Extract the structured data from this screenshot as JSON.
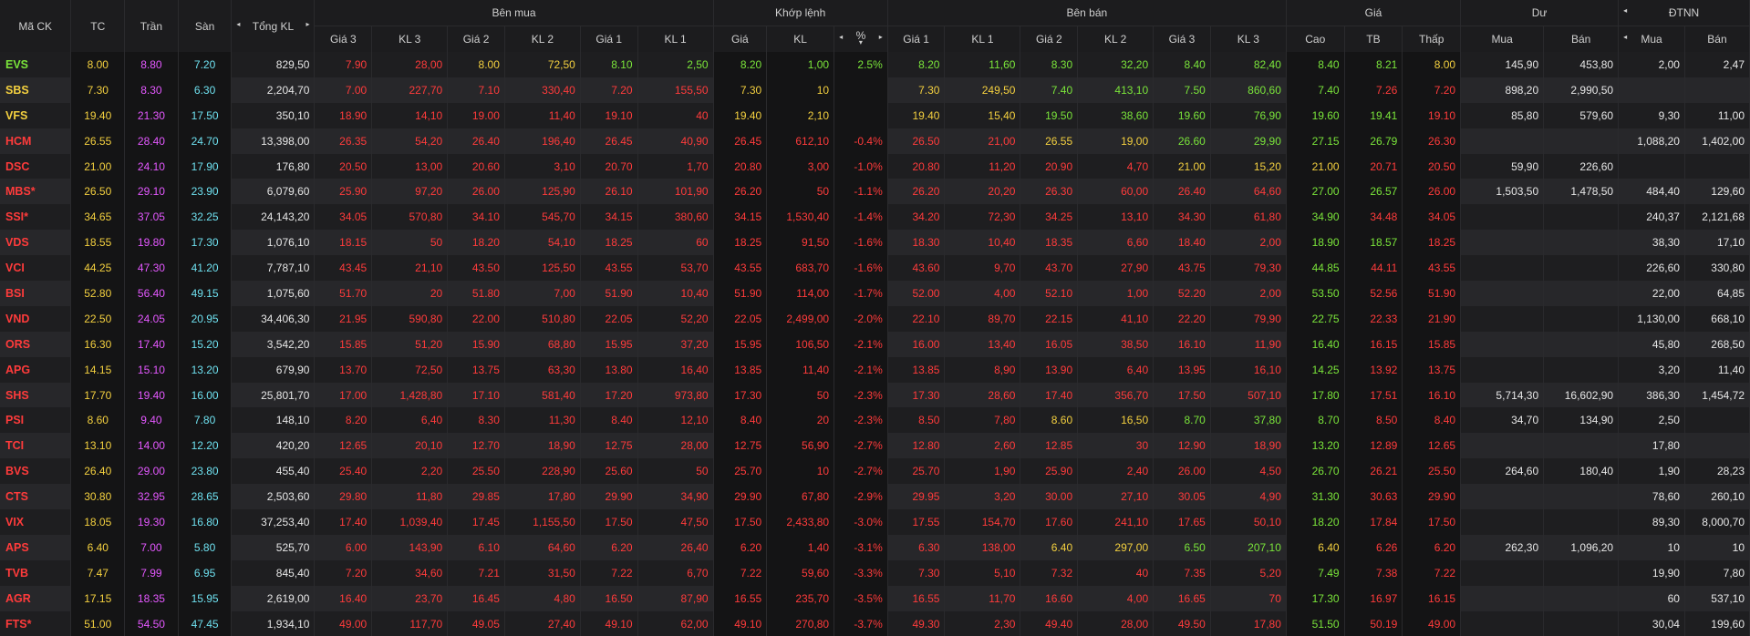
{
  "header": {
    "symbol": "Mã CK",
    "tc": "TC",
    "tran": "Trần",
    "san": "Sàn",
    "total_vol": "Tổng KL",
    "buy_group": "Bên mua",
    "match_group": "Khớp lệnh",
    "sell_group": "Bên bán",
    "price_group": "Giá",
    "residual_group": "Dư",
    "foreign_group": "ĐTNN",
    "gia3": "Giá 3",
    "kl3": "KL 3",
    "gia2": "Giá 2",
    "kl2": "KL 2",
    "gia1": "Giá 1",
    "kl1": "KL 1",
    "match_price": "Giá",
    "match_vol": "KL",
    "match_pct": "%",
    "high": "Cao",
    "avg": "TB",
    "low": "Thấp",
    "res_buy": "Mua",
    "res_sell": "Bán",
    "f_buy": "Mua",
    "f_sell": "Bán"
  },
  "icons": {
    "arrow_left": "◂",
    "arrow_right": "▸",
    "sort_down": "▾"
  },
  "colors": {
    "up": "#7ae43a",
    "down": "#ff3b3b",
    "reference": "#f4d03f",
    "ceiling": "#e458ff",
    "floor": "#6ee0ef"
  },
  "rows": [
    {
      "sym": "EVS",
      "st": "up",
      "tc": "8.00",
      "tr": "8.80",
      "sa": "7.20",
      "tot": "829,50",
      "b3p": "7.90",
      "b3pc": "dn",
      "b3v": "28,00",
      "b2p": "8.00",
      "b2pc": "ref",
      "b2v": "72,50",
      "b1p": "8.10",
      "b1pc": "up",
      "b1v": "2,50",
      "mp": "8.20",
      "mv": "1,00",
      "mpct": "2.5%",
      "mc": "up",
      "s1p": "8.20",
      "s1pc": "up",
      "s1v": "11,60",
      "s2p": "8.30",
      "s2pc": "up",
      "s2v": "32,20",
      "s3p": "8.40",
      "s3pc": "up",
      "s3v": "82,40",
      "hi": "8.40",
      "hic": "up",
      "av": "8.21",
      "avc": "up",
      "lo": "8.00",
      "loc": "ref",
      "rb": "145,90",
      "rs": "453,80",
      "fb": "2,00",
      "fs": "2,47"
    },
    {
      "sym": "SBS",
      "st": "ref",
      "tc": "7.30",
      "tr": "8.30",
      "sa": "6.30",
      "tot": "2,204,70",
      "b3p": "7.00",
      "b3pc": "dn",
      "b3v": "227,70",
      "b2p": "7.10",
      "b2pc": "dn",
      "b2v": "330,40",
      "b1p": "7.20",
      "b1pc": "dn",
      "b1v": "155,50",
      "mp": "7.30",
      "mv": "10",
      "mpct": "",
      "mc": "ref",
      "s1p": "7.30",
      "s1pc": "ref",
      "s1v": "249,50",
      "s2p": "7.40",
      "s2pc": "up",
      "s2v": "413,10",
      "s3p": "7.50",
      "s3pc": "up",
      "s3v": "860,60",
      "hi": "7.40",
      "hic": "up",
      "av": "7.26",
      "avc": "dn",
      "lo": "7.20",
      "loc": "dn",
      "rb": "898,20",
      "rs": "2,990,50",
      "fb": "",
      "fs": ""
    },
    {
      "sym": "VFS",
      "st": "ref",
      "tc": "19.40",
      "tr": "21.30",
      "sa": "17.50",
      "tot": "350,10",
      "b3p": "18.90",
      "b3pc": "dn",
      "b3v": "14,10",
      "b2p": "19.00",
      "b2pc": "dn",
      "b2v": "11,40",
      "b1p": "19.10",
      "b1pc": "dn",
      "b1v": "40",
      "mp": "19.40",
      "mv": "2,10",
      "mpct": "",
      "mc": "ref",
      "s1p": "19.40",
      "s1pc": "ref",
      "s1v": "15,40",
      "s2p": "19.50",
      "s2pc": "up",
      "s2v": "38,60",
      "s3p": "19.60",
      "s3pc": "up",
      "s3v": "76,90",
      "hi": "19.60",
      "hic": "up",
      "av": "19.41",
      "avc": "up",
      "lo": "19.10",
      "loc": "dn",
      "rb": "85,80",
      "rs": "579,60",
      "fb": "9,30",
      "fs": "11,00"
    },
    {
      "sym": "HCM",
      "st": "dn",
      "tc": "26.55",
      "tr": "28.40",
      "sa": "24.70",
      "tot": "13,398,00",
      "b3p": "26.35",
      "b3pc": "dn",
      "b3v": "54,20",
      "b2p": "26.40",
      "b2pc": "dn",
      "b2v": "196,40",
      "b1p": "26.45",
      "b1pc": "dn",
      "b1v": "40,90",
      "mp": "26.45",
      "mv": "612,10",
      "mpct": "-0.4%",
      "mc": "dn",
      "s1p": "26.50",
      "s1pc": "dn",
      "s1v": "21,00",
      "s2p": "26.55",
      "s2pc": "ref",
      "s2v": "19,00",
      "s3p": "26.60",
      "s3pc": "up",
      "s3v": "29,90",
      "hi": "27.15",
      "hic": "up",
      "av": "26.79",
      "avc": "up",
      "lo": "26.30",
      "loc": "dn",
      "rb": "",
      "rs": "",
      "fb": "1,088,20",
      "fs": "1,402,00"
    },
    {
      "sym": "DSC",
      "st": "dn",
      "tc": "21.00",
      "tr": "24.10",
      "sa": "17.90",
      "tot": "176,80",
      "b3p": "20.50",
      "b3pc": "dn",
      "b3v": "13,00",
      "b2p": "20.60",
      "b2pc": "dn",
      "b2v": "3,10",
      "b1p": "20.70",
      "b1pc": "dn",
      "b1v": "1,70",
      "mp": "20.80",
      "mv": "3,00",
      "mpct": "-1.0%",
      "mc": "dn",
      "s1p": "20.80",
      "s1pc": "dn",
      "s1v": "11,20",
      "s2p": "20.90",
      "s2pc": "dn",
      "s2v": "4,70",
      "s3p": "21.00",
      "s3pc": "ref",
      "s3v": "15,20",
      "hi": "21.00",
      "hic": "ref",
      "av": "20.71",
      "avc": "dn",
      "lo": "20.50",
      "loc": "dn",
      "rb": "59,90",
      "rs": "226,60",
      "fb": "",
      "fs": ""
    },
    {
      "sym": "MBS*",
      "st": "dn",
      "tc": "26.50",
      "tr": "29.10",
      "sa": "23.90",
      "tot": "6,079,60",
      "b3p": "25.90",
      "b3pc": "dn",
      "b3v": "97,20",
      "b2p": "26.00",
      "b2pc": "dn",
      "b2v": "125,90",
      "b1p": "26.10",
      "b1pc": "dn",
      "b1v": "101,90",
      "mp": "26.20",
      "mv": "50",
      "mpct": "-1.1%",
      "mc": "dn",
      "s1p": "26.20",
      "s1pc": "dn",
      "s1v": "20,20",
      "s2p": "26.30",
      "s2pc": "dn",
      "s2v": "60,00",
      "s3p": "26.40",
      "s3pc": "dn",
      "s3v": "64,60",
      "hi": "27.00",
      "hic": "up",
      "av": "26.57",
      "avc": "up",
      "lo": "26.00",
      "loc": "dn",
      "rb": "1,503,50",
      "rs": "1,478,50",
      "fb": "484,40",
      "fs": "129,60"
    },
    {
      "sym": "SSI*",
      "st": "dn",
      "tc": "34.65",
      "tr": "37.05",
      "sa": "32.25",
      "tot": "24,143,20",
      "b3p": "34.05",
      "b3pc": "dn",
      "b3v": "570,80",
      "b2p": "34.10",
      "b2pc": "dn",
      "b2v": "545,70",
      "b1p": "34.15",
      "b1pc": "dn",
      "b1v": "380,60",
      "mp": "34.15",
      "mv": "1,530,40",
      "mpct": "-1.4%",
      "mc": "dn",
      "s1p": "34.20",
      "s1pc": "dn",
      "s1v": "72,30",
      "s2p": "34.25",
      "s2pc": "dn",
      "s2v": "13,10",
      "s3p": "34.30",
      "s3pc": "dn",
      "s3v": "61,80",
      "hi": "34.90",
      "hic": "up",
      "av": "34.48",
      "avc": "dn",
      "lo": "34.05",
      "loc": "dn",
      "rb": "",
      "rs": "",
      "fb": "240,37",
      "fs": "2,121,68"
    },
    {
      "sym": "VDS",
      "st": "dn",
      "tc": "18.55",
      "tr": "19.80",
      "sa": "17.30",
      "tot": "1,076,10",
      "b3p": "18.15",
      "b3pc": "dn",
      "b3v": "50",
      "b2p": "18.20",
      "b2pc": "dn",
      "b2v": "54,10",
      "b1p": "18.25",
      "b1pc": "dn",
      "b1v": "60",
      "mp": "18.25",
      "mv": "91,50",
      "mpct": "-1.6%",
      "mc": "dn",
      "s1p": "18.30",
      "s1pc": "dn",
      "s1v": "10,40",
      "s2p": "18.35",
      "s2pc": "dn",
      "s2v": "6,60",
      "s3p": "18.40",
      "s3pc": "dn",
      "s3v": "2,00",
      "hi": "18.90",
      "hic": "up",
      "av": "18.57",
      "avc": "up",
      "lo": "18.25",
      "loc": "dn",
      "rb": "",
      "rs": "",
      "fb": "38,30",
      "fs": "17,10"
    },
    {
      "sym": "VCI",
      "st": "dn",
      "tc": "44.25",
      "tr": "47.30",
      "sa": "41.20",
      "tot": "7,787,10",
      "b3p": "43.45",
      "b3pc": "dn",
      "b3v": "21,10",
      "b2p": "43.50",
      "b2pc": "dn",
      "b2v": "125,50",
      "b1p": "43.55",
      "b1pc": "dn",
      "b1v": "53,70",
      "mp": "43.55",
      "mv": "683,70",
      "mpct": "-1.6%",
      "mc": "dn",
      "s1p": "43.60",
      "s1pc": "dn",
      "s1v": "9,70",
      "s2p": "43.70",
      "s2pc": "dn",
      "s2v": "27,90",
      "s3p": "43.75",
      "s3pc": "dn",
      "s3v": "79,30",
      "hi": "44.85",
      "hic": "up",
      "av": "44.11",
      "avc": "dn",
      "lo": "43.55",
      "loc": "dn",
      "rb": "",
      "rs": "",
      "fb": "226,60",
      "fs": "330,80"
    },
    {
      "sym": "BSI",
      "st": "dn",
      "tc": "52.80",
      "tr": "56.40",
      "sa": "49.15",
      "tot": "1,075,60",
      "b3p": "51.70",
      "b3pc": "dn",
      "b3v": "20",
      "b2p": "51.80",
      "b2pc": "dn",
      "b2v": "7,00",
      "b1p": "51.90",
      "b1pc": "dn",
      "b1v": "10,40",
      "mp": "51.90",
      "mv": "114,00",
      "mpct": "-1.7%",
      "mc": "dn",
      "s1p": "52.00",
      "s1pc": "dn",
      "s1v": "4,00",
      "s2p": "52.10",
      "s2pc": "dn",
      "s2v": "1,00",
      "s3p": "52.20",
      "s3pc": "dn",
      "s3v": "2,00",
      "hi": "53.50",
      "hic": "up",
      "av": "52.56",
      "avc": "dn",
      "lo": "51.90",
      "loc": "dn",
      "rb": "",
      "rs": "",
      "fb": "22,00",
      "fs": "64,85"
    },
    {
      "sym": "VND",
      "st": "dn",
      "tc": "22.50",
      "tr": "24.05",
      "sa": "20.95",
      "tot": "34,406,30",
      "b3p": "21.95",
      "b3pc": "dn",
      "b3v": "590,80",
      "b2p": "22.00",
      "b2pc": "dn",
      "b2v": "510,80",
      "b1p": "22.05",
      "b1pc": "dn",
      "b1v": "52,20",
      "mp": "22.05",
      "mv": "2,499,00",
      "mpct": "-2.0%",
      "mc": "dn",
      "s1p": "22.10",
      "s1pc": "dn",
      "s1v": "89,70",
      "s2p": "22.15",
      "s2pc": "dn",
      "s2v": "41,10",
      "s3p": "22.20",
      "s3pc": "dn",
      "s3v": "79,90",
      "hi": "22.75",
      "hic": "up",
      "av": "22.33",
      "avc": "dn",
      "lo": "21.90",
      "loc": "dn",
      "rb": "",
      "rs": "",
      "fb": "1,130,00",
      "fs": "668,10"
    },
    {
      "sym": "ORS",
      "st": "dn",
      "tc": "16.30",
      "tr": "17.40",
      "sa": "15.20",
      "tot": "3,542,20",
      "b3p": "15.85",
      "b3pc": "dn",
      "b3v": "51,20",
      "b2p": "15.90",
      "b2pc": "dn",
      "b2v": "68,80",
      "b1p": "15.95",
      "b1pc": "dn",
      "b1v": "37,20",
      "mp": "15.95",
      "mv": "106,50",
      "mpct": "-2.1%",
      "mc": "dn",
      "s1p": "16.00",
      "s1pc": "dn",
      "s1v": "13,40",
      "s2p": "16.05",
      "s2pc": "dn",
      "s2v": "38,50",
      "s3p": "16.10",
      "s3pc": "dn",
      "s3v": "11,90",
      "hi": "16.40",
      "hic": "up",
      "av": "16.15",
      "avc": "dn",
      "lo": "15.85",
      "loc": "dn",
      "rb": "",
      "rs": "",
      "fb": "45,80",
      "fs": "268,50"
    },
    {
      "sym": "APG",
      "st": "dn",
      "tc": "14.15",
      "tr": "15.10",
      "sa": "13.20",
      "tot": "679,90",
      "b3p": "13.70",
      "b3pc": "dn",
      "b3v": "72,50",
      "b2p": "13.75",
      "b2pc": "dn",
      "b2v": "63,30",
      "b1p": "13.80",
      "b1pc": "dn",
      "b1v": "16,40",
      "mp": "13.85",
      "mv": "11,40",
      "mpct": "-2.1%",
      "mc": "dn",
      "s1p": "13.85",
      "s1pc": "dn",
      "s1v": "8,90",
      "s2p": "13.90",
      "s2pc": "dn",
      "s2v": "6,40",
      "s3p": "13.95",
      "s3pc": "dn",
      "s3v": "16,10",
      "hi": "14.25",
      "hic": "up",
      "av": "13.92",
      "avc": "dn",
      "lo": "13.75",
      "loc": "dn",
      "rb": "",
      "rs": "",
      "fb": "3,20",
      "fs": "11,40"
    },
    {
      "sym": "SHS",
      "st": "dn",
      "tc": "17.70",
      "tr": "19.40",
      "sa": "16.00",
      "tot": "25,801,70",
      "b3p": "17.00",
      "b3pc": "dn",
      "b3v": "1,428,80",
      "b2p": "17.10",
      "b2pc": "dn",
      "b2v": "581,40",
      "b1p": "17.20",
      "b1pc": "dn",
      "b1v": "973,80",
      "mp": "17.30",
      "mv": "50",
      "mpct": "-2.3%",
      "mc": "dn",
      "s1p": "17.30",
      "s1pc": "dn",
      "s1v": "28,60",
      "s2p": "17.40",
      "s2pc": "dn",
      "s2v": "356,70",
      "s3p": "17.50",
      "s3pc": "dn",
      "s3v": "507,10",
      "hi": "17.80",
      "hic": "up",
      "av": "17.51",
      "avc": "dn",
      "lo": "16.10",
      "loc": "dn",
      "rb": "5,714,30",
      "rs": "16,602,90",
      "fb": "386,30",
      "fs": "1,454,72"
    },
    {
      "sym": "PSI",
      "st": "dn",
      "tc": "8.60",
      "tr": "9.40",
      "sa": "7.80",
      "tot": "148,10",
      "b3p": "8.20",
      "b3pc": "dn",
      "b3v": "6,40",
      "b2p": "8.30",
      "b2pc": "dn",
      "b2v": "11,30",
      "b1p": "8.40",
      "b1pc": "dn",
      "b1v": "12,10",
      "mp": "8.40",
      "mv": "20",
      "mpct": "-2.3%",
      "mc": "dn",
      "s1p": "8.50",
      "s1pc": "dn",
      "s1v": "7,80",
      "s2p": "8.60",
      "s2pc": "ref",
      "s2v": "16,50",
      "s3p": "8.70",
      "s3pc": "up",
      "s3v": "37,80",
      "hi": "8.70",
      "hic": "up",
      "av": "8.50",
      "avc": "dn",
      "lo": "8.40",
      "loc": "dn",
      "rb": "34,70",
      "rs": "134,90",
      "fb": "2,50",
      "fs": ""
    },
    {
      "sym": "TCI",
      "st": "dn",
      "tc": "13.10",
      "tr": "14.00",
      "sa": "12.20",
      "tot": "420,20",
      "b3p": "12.65",
      "b3pc": "dn",
      "b3v": "20,10",
      "b2p": "12.70",
      "b2pc": "dn",
      "b2v": "18,90",
      "b1p": "12.75",
      "b1pc": "dn",
      "b1v": "28,00",
      "mp": "12.75",
      "mv": "56,90",
      "mpct": "-2.7%",
      "mc": "dn",
      "s1p": "12.80",
      "s1pc": "dn",
      "s1v": "2,60",
      "s2p": "12.85",
      "s2pc": "dn",
      "s2v": "30",
      "s3p": "12.90",
      "s3pc": "dn",
      "s3v": "18,90",
      "hi": "13.20",
      "hic": "up",
      "av": "12.89",
      "avc": "dn",
      "lo": "12.65",
      "loc": "dn",
      "rb": "",
      "rs": "",
      "fb": "17,80",
      "fs": ""
    },
    {
      "sym": "BVS",
      "st": "dn",
      "tc": "26.40",
      "tr": "29.00",
      "sa": "23.80",
      "tot": "455,40",
      "b3p": "25.40",
      "b3pc": "dn",
      "b3v": "2,20",
      "b2p": "25.50",
      "b2pc": "dn",
      "b2v": "228,90",
      "b1p": "25.60",
      "b1pc": "dn",
      "b1v": "50",
      "mp": "25.70",
      "mv": "10",
      "mpct": "-2.7%",
      "mc": "dn",
      "s1p": "25.70",
      "s1pc": "dn",
      "s1v": "1,90",
      "s2p": "25.90",
      "s2pc": "dn",
      "s2v": "2,40",
      "s3p": "26.00",
      "s3pc": "dn",
      "s3v": "4,50",
      "hi": "26.70",
      "hic": "up",
      "av": "26.21",
      "avc": "dn",
      "lo": "25.50",
      "loc": "dn",
      "rb": "264,60",
      "rs": "180,40",
      "fb": "1,90",
      "fs": "28,23"
    },
    {
      "sym": "CTS",
      "st": "dn",
      "tc": "30.80",
      "tr": "32.95",
      "sa": "28.65",
      "tot": "2,503,60",
      "b3p": "29.80",
      "b3pc": "dn",
      "b3v": "11,80",
      "b2p": "29.85",
      "b2pc": "dn",
      "b2v": "17,80",
      "b1p": "29.90",
      "b1pc": "dn",
      "b1v": "34,90",
      "mp": "29.90",
      "mv": "67,80",
      "mpct": "-2.9%",
      "mc": "dn",
      "s1p": "29.95",
      "s1pc": "dn",
      "s1v": "3,20",
      "s2p": "30.00",
      "s2pc": "dn",
      "s2v": "27,10",
      "s3p": "30.05",
      "s3pc": "dn",
      "s3v": "4,90",
      "hi": "31.30",
      "hic": "up",
      "av": "30.63",
      "avc": "dn",
      "lo": "29.90",
      "loc": "dn",
      "rb": "",
      "rs": "",
      "fb": "78,60",
      "fs": "260,10"
    },
    {
      "sym": "VIX",
      "st": "dn",
      "tc": "18.05",
      "tr": "19.30",
      "sa": "16.80",
      "tot": "37,253,40",
      "b3p": "17.40",
      "b3pc": "dn",
      "b3v": "1,039,40",
      "b2p": "17.45",
      "b2pc": "dn",
      "b2v": "1,155,50",
      "b1p": "17.50",
      "b1pc": "dn",
      "b1v": "47,50",
      "mp": "17.50",
      "mv": "2,433,80",
      "mpct": "-3.0%",
      "mc": "dn",
      "s1p": "17.55",
      "s1pc": "dn",
      "s1v": "154,70",
      "s2p": "17.60",
      "s2pc": "dn",
      "s2v": "241,10",
      "s3p": "17.65",
      "s3pc": "dn",
      "s3v": "50,10",
      "hi": "18.20",
      "hic": "up",
      "av": "17.84",
      "avc": "dn",
      "lo": "17.50",
      "loc": "dn",
      "rb": "",
      "rs": "",
      "fb": "89,30",
      "fs": "8,000,70"
    },
    {
      "sym": "APS",
      "st": "dn",
      "tc": "6.40",
      "tr": "7.00",
      "sa": "5.80",
      "tot": "525,70",
      "b3p": "6.00",
      "b3pc": "dn",
      "b3v": "143,90",
      "b2p": "6.10",
      "b2pc": "dn",
      "b2v": "64,60",
      "b1p": "6.20",
      "b1pc": "dn",
      "b1v": "26,40",
      "mp": "6.20",
      "mv": "1,40",
      "mpct": "-3.1%",
      "mc": "dn",
      "s1p": "6.30",
      "s1pc": "dn",
      "s1v": "138,00",
      "s2p": "6.40",
      "s2pc": "ref",
      "s2v": "297,00",
      "s3p": "6.50",
      "s3pc": "up",
      "s3v": "207,10",
      "hi": "6.40",
      "hic": "ref",
      "av": "6.26",
      "avc": "dn",
      "lo": "6.20",
      "loc": "dn",
      "rb": "262,30",
      "rs": "1,096,20",
      "fb": "10",
      "fs": "10"
    },
    {
      "sym": "TVB",
      "st": "dn",
      "tc": "7.47",
      "tr": "7.99",
      "sa": "6.95",
      "tot": "845,40",
      "b3p": "7.20",
      "b3pc": "dn",
      "b3v": "34,60",
      "b2p": "7.21",
      "b2pc": "dn",
      "b2v": "31,50",
      "b1p": "7.22",
      "b1pc": "dn",
      "b1v": "6,70",
      "mp": "7.22",
      "mv": "59,60",
      "mpct": "-3.3%",
      "mc": "dn",
      "s1p": "7.30",
      "s1pc": "dn",
      "s1v": "5,10",
      "s2p": "7.32",
      "s2pc": "dn",
      "s2v": "40",
      "s3p": "7.35",
      "s3pc": "dn",
      "s3v": "5,20",
      "hi": "7.49",
      "hic": "up",
      "av": "7.38",
      "avc": "dn",
      "lo": "7.22",
      "loc": "dn",
      "rb": "",
      "rs": "",
      "fb": "19,90",
      "fs": "7,80"
    },
    {
      "sym": "AGR",
      "st": "dn",
      "tc": "17.15",
      "tr": "18.35",
      "sa": "15.95",
      "tot": "2,619,00",
      "b3p": "16.40",
      "b3pc": "dn",
      "b3v": "23,70",
      "b2p": "16.45",
      "b2pc": "dn",
      "b2v": "4,80",
      "b1p": "16.50",
      "b1pc": "dn",
      "b1v": "87,90",
      "mp": "16.55",
      "mv": "235,70",
      "mpct": "-3.5%",
      "mc": "dn",
      "s1p": "16.55",
      "s1pc": "dn",
      "s1v": "11,70",
      "s2p": "16.60",
      "s2pc": "dn",
      "s2v": "4,00",
      "s3p": "16.65",
      "s3pc": "dn",
      "s3v": "70",
      "hi": "17.30",
      "hic": "up",
      "av": "16.97",
      "avc": "dn",
      "lo": "16.15",
      "loc": "dn",
      "rb": "",
      "rs": "",
      "fb": "60",
      "fs": "537,10"
    },
    {
      "sym": "FTS*",
      "st": "dn",
      "tc": "51.00",
      "tr": "54.50",
      "sa": "47.45",
      "tot": "1,934,10",
      "b3p": "49.00",
      "b3pc": "dn",
      "b3v": "117,70",
      "b2p": "49.05",
      "b2pc": "dn",
      "b2v": "27,40",
      "b1p": "49.10",
      "b1pc": "dn",
      "b1v": "62,00",
      "mp": "49.10",
      "mv": "270,80",
      "mpct": "-3.7%",
      "mc": "dn",
      "s1p": "49.30",
      "s1pc": "dn",
      "s1v": "2,30",
      "s2p": "49.40",
      "s2pc": "dn",
      "s2v": "28,00",
      "s3p": "49.50",
      "s3pc": "dn",
      "s3v": "17,80",
      "hi": "51.50",
      "hic": "up",
      "av": "50.19",
      "avc": "dn",
      "lo": "49.00",
      "loc": "dn",
      "rb": "",
      "rs": "",
      "fb": "30,04",
      "fs": "199,60"
    }
  ]
}
